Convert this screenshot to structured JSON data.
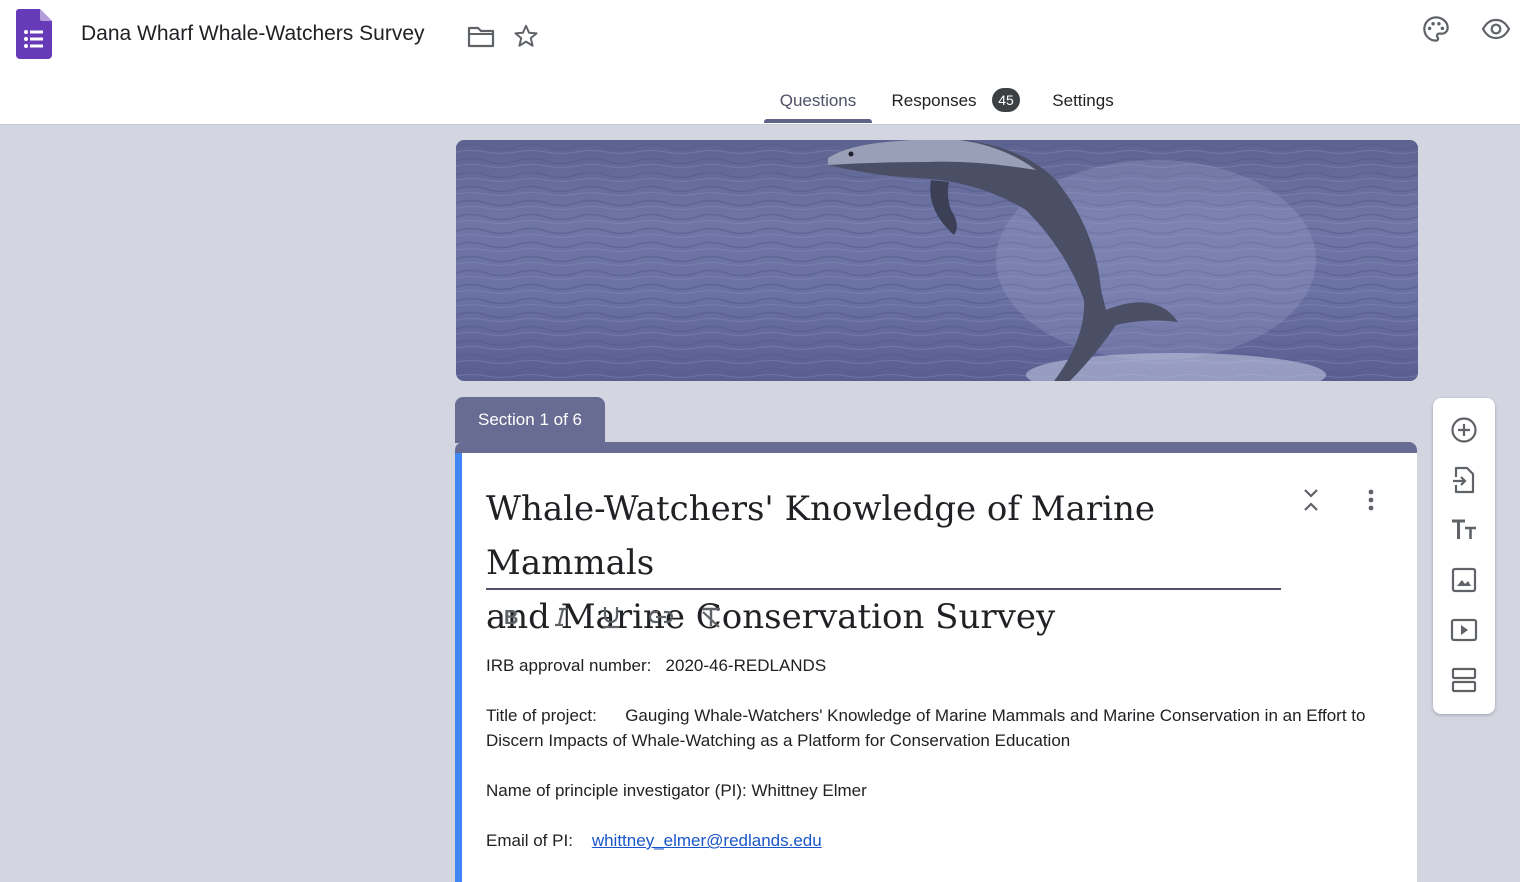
{
  "app": {
    "document_title": "Dana Wharf Whale-Watchers Survey"
  },
  "tabs": [
    {
      "label": "Questions",
      "active": true
    },
    {
      "label": "Responses",
      "badge": "45"
    },
    {
      "label": "Settings"
    }
  ],
  "section": {
    "label": "Section 1 of 6"
  },
  "form": {
    "title_line1": "Whale-Watchers' Knowledge of Marine Mammals",
    "title_line2": "and Marine Conservation Survey",
    "description": {
      "irb_label": "IRB approval number:",
      "irb_value": "2020-46-REDLANDS",
      "project_label": "Title of project:",
      "project_value": "Gauging Whale-Watchers' Knowledge of Marine Mammals and Marine Conservation in an Effort to Discern Impacts of Whale-Watching as a Platform for Conservation Education",
      "pi_label": "Name of principle investigator (PI):",
      "pi_value": "Whittney Elmer",
      "email_label": "Email of PI:",
      "email_value": "whittney_elmer@redlands.edu"
    }
  },
  "icons": {
    "header": [
      "forms-logo-icon",
      "folder-icon",
      "star-icon",
      "palette-icon",
      "preview-eye-icon"
    ],
    "formatting": [
      "bold-icon",
      "italic-icon",
      "underline-icon",
      "link-icon",
      "clear-formatting-icon"
    ],
    "card_actions": [
      "collapse-icon",
      "more-options-icon"
    ],
    "sidebar_tools": [
      "add-question-icon",
      "import-questions-icon",
      "add-title-icon",
      "add-image-icon",
      "add-video-icon",
      "add-section-icon"
    ]
  },
  "colors": {
    "theme": "#686c93",
    "background": "#d3d5e1",
    "accent_left_bar": "#4285f4",
    "forms_purple": "#673ab7",
    "link": "#1a56c9"
  }
}
